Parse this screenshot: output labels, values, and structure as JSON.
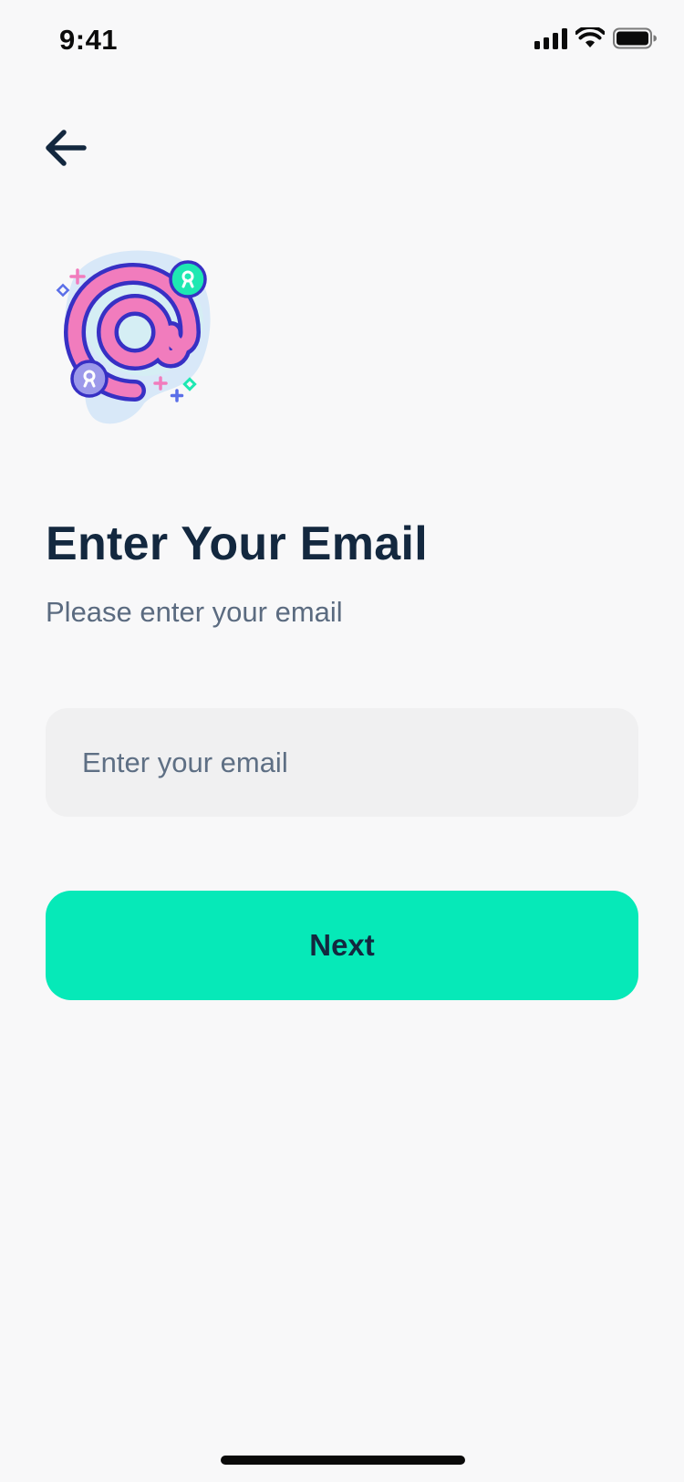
{
  "status_bar": {
    "time": "9:41",
    "icons": [
      "cellular-signal-icon",
      "wifi-icon",
      "battery-icon"
    ]
  },
  "nav": {
    "back_icon": "arrow-left-icon"
  },
  "illustration": {
    "icon": "at-sign-illustration"
  },
  "content": {
    "title": "Enter Your Email",
    "subtitle": "Please enter your email"
  },
  "form": {
    "email_value": "",
    "email_placeholder": "Enter your email",
    "next_label": "Next"
  },
  "colors": {
    "background": "#f8f8f9",
    "text_primary": "#13283f",
    "text_secondary": "#5b6b80",
    "input_background": "#f0f0f1",
    "accent": "#06e9b8",
    "illustration_pink": "#f17cbd",
    "illustration_indigo": "#3730c4"
  }
}
